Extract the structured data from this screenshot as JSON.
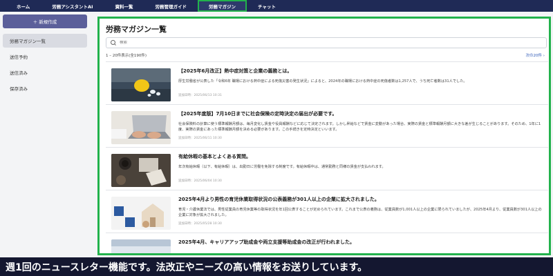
{
  "nav": {
    "items": [
      {
        "label": "ホーム"
      },
      {
        "label": "労務アシスタントAI"
      },
      {
        "label": "資料一覧"
      },
      {
        "label": "労務管理ガイド"
      },
      {
        "label": "労務マガジン"
      },
      {
        "label": "チャット"
      }
    ],
    "active_index": 4
  },
  "sidebar": {
    "new_button": "＋ 新規作成",
    "items": [
      {
        "label": "労務マガジン一覧"
      },
      {
        "label": "送信予約"
      },
      {
        "label": "送信済み"
      },
      {
        "label": "保存済み"
      }
    ]
  },
  "main": {
    "title": "労務マガジン一覧",
    "search_placeholder": "検索",
    "result_count": "1 – 20件表示(全190件)",
    "next_link": "次の20件 ›"
  },
  "articles": [
    {
      "title": "【2025年6月改正】熱中症対策と企業の義務とは。",
      "desc": "厚生労働省が公表した「令和6年 職場における熱中症による死傷災害の発生状況」によると、2024年の職場における熱中症の死傷者数は1,257人で、うち死亡者数は31人でした。",
      "date": "追加日時：2025/06/13 10:31"
    },
    {
      "title": "【2025年度版】7月10日までに社会保険の定時決定の届出が必要です。",
      "desc": "社会保険料の計算に使う標準報酬月額は、毎月変化し賃金や役員報酬などに応じて決定されます。しかし昇給などで賃金に変動があった場合、実際の賃金と標準報酬月額に大きな差が生じることがあります。そのため、1年に1度、実際の賃金にあった標準報酬月額を決める必要があります。この手続きを定時決定といいます。",
      "date": "追加日時：2025/06/11 10:30"
    },
    {
      "title": "有給休暇の基本とよくある質問。",
      "desc": "年次有給休暇（以下、有給休暇）は、出勤日に労働を免除する制度です。有給休暇中は、通常勤務と同様の賃金が支払われます。",
      "date": "追加日時：2025/06/04 10:30"
    },
    {
      "title": "2025年4月より男性の育児休業取得状況の公表義務が301人以上の企業に拡大されました。",
      "desc": "育児・介護休業法では、男性従業員の育児休業等の取得状況を年1回公表することが定められています。これまで公表の義務は、従業員数が1,001人以上の企業に限られていましたが、2025年4月より、従業員数が301人以上の企業に対象が拡大されました。",
      "date": "追加日時：2025/05/28 10:30"
    },
    {
      "title": "2025年4月、キャリアアップ助成金や両立支援等助成金の改正が行われました。",
      "desc": "",
      "date": ""
    }
  ],
  "caption": "週1回のニュースレター機能です。法改正やニーズの高い情報をお送りしています。",
  "colors": {
    "nav_bg": "#1f2a56",
    "highlight": "#22b24c",
    "primary_button": "#5b5f9a",
    "caption_bg": "#141730"
  }
}
